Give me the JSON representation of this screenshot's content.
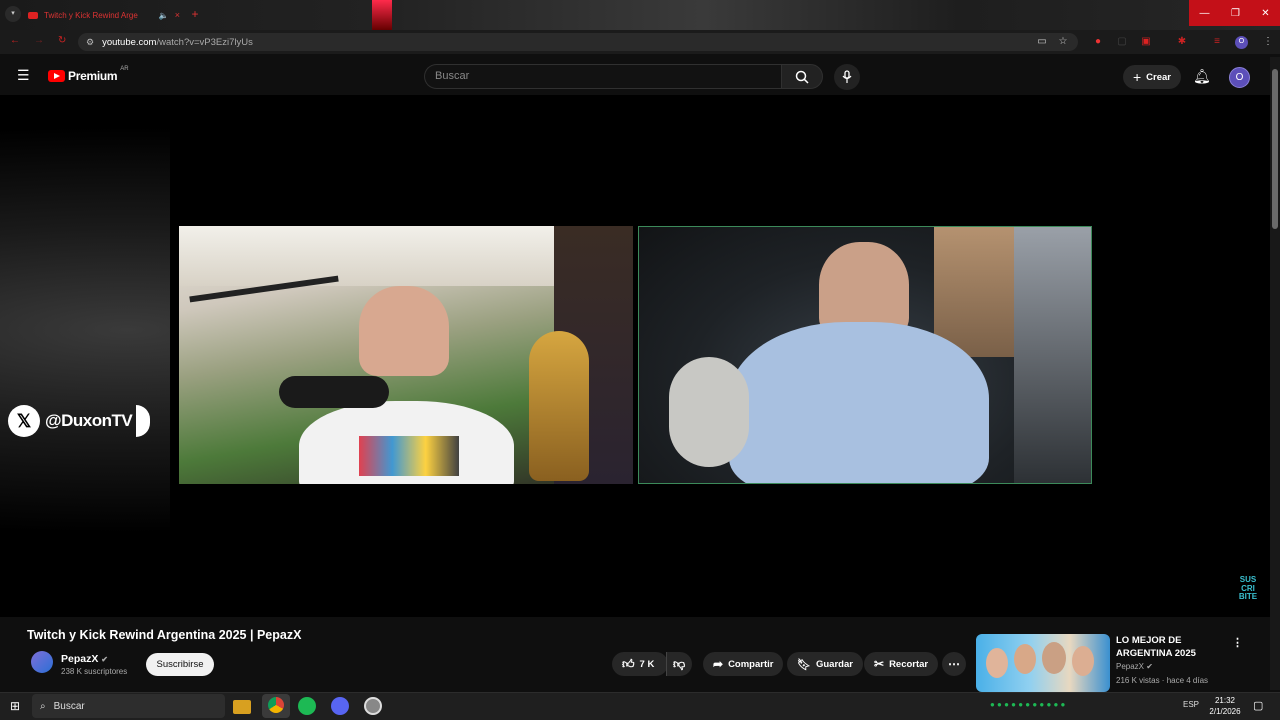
{
  "browser": {
    "tab_title": "Twitch y Kick Rewind Arge",
    "tab_close": "×",
    "new_tab": "+",
    "url_host": "youtube.com",
    "url_path": "/watch?v=vP3Ezi7lyUs",
    "window_minimize": "—",
    "window_restore": "❐",
    "window_close": "✕"
  },
  "youtube": {
    "logo_text": "Premium",
    "logo_region": "AR",
    "search_placeholder": "Buscar",
    "create_label": "Crear",
    "avatar_letter": "O"
  },
  "video": {
    "overlay_handle": "@DuxonTV",
    "overlay_subscribe": "SUS CRI BITE",
    "title": "Twitch y Kick Rewind Argentina 2025 | PepazX",
    "channel_name": "PepazX",
    "channel_subs": "238 K suscriptores",
    "subscribe_label": "Suscribirse",
    "likes": "7 K",
    "share_label": "Compartir",
    "save_label": "Guardar",
    "clip_label": "Recortar"
  },
  "recommended": {
    "title": "LO MEJOR DE ARGENTINA 2025",
    "channel": "PepazX",
    "meta": "216 K vistas · hace 4 días"
  },
  "taskbar": {
    "search_placeholder": "Buscar",
    "language": "ESP",
    "time": "21:32",
    "date": "2/1/2026"
  },
  "colors": {
    "accent_red": "#ff0000",
    "window_close_red": "#c41018",
    "avatar_purple": "#5c4fb9",
    "cam_border_green": "#3c8a5a"
  }
}
